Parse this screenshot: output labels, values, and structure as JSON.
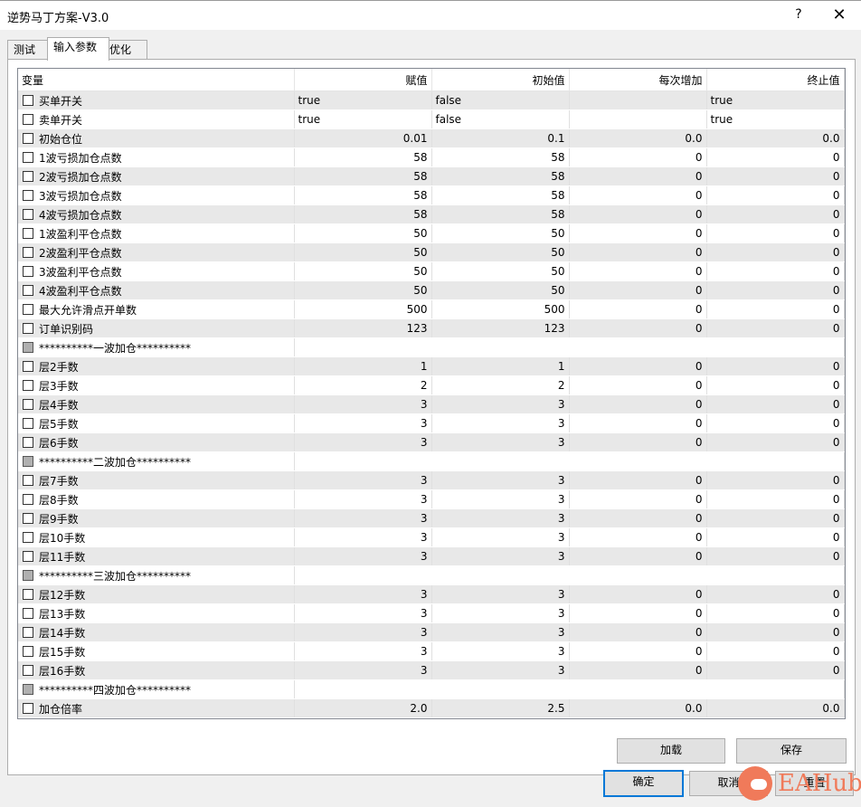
{
  "window": {
    "title": "逆势马丁方案-V3.0",
    "help": "?",
    "close": "✕"
  },
  "tabs": [
    "测试",
    "输入参数",
    "优化"
  ],
  "columns": [
    "变量",
    "赋值",
    "初始值",
    "每次增加",
    "终止值"
  ],
  "rows": [
    {
      "name": "买单开关",
      "value": "true",
      "start": "false",
      "step": "",
      "stop": "true",
      "type": "text"
    },
    {
      "name": "卖单开关",
      "value": "true",
      "start": "false",
      "step": "",
      "stop": "true",
      "type": "text"
    },
    {
      "name": "初始仓位",
      "value": "0.01",
      "start": "0.1",
      "step": "0.0",
      "stop": "0.0",
      "type": "num"
    },
    {
      "name": "1波亏损加仓点数",
      "value": "58",
      "start": "58",
      "step": "0",
      "stop": "0",
      "type": "num"
    },
    {
      "name": "2波亏损加仓点数",
      "value": "58",
      "start": "58",
      "step": "0",
      "stop": "0",
      "type": "num"
    },
    {
      "name": "3波亏损加仓点数",
      "value": "58",
      "start": "58",
      "step": "0",
      "stop": "0",
      "type": "num"
    },
    {
      "name": "4波亏损加仓点数",
      "value": "58",
      "start": "58",
      "step": "0",
      "stop": "0",
      "type": "num"
    },
    {
      "name": "1波盈利平仓点数",
      "value": "50",
      "start": "50",
      "step": "0",
      "stop": "0",
      "type": "num"
    },
    {
      "name": "2波盈利平仓点数",
      "value": "50",
      "start": "50",
      "step": "0",
      "stop": "0",
      "type": "num"
    },
    {
      "name": "3波盈利平仓点数",
      "value": "50",
      "start": "50",
      "step": "0",
      "stop": "0",
      "type": "num"
    },
    {
      "name": "4波盈利平仓点数",
      "value": "50",
      "start": "50",
      "step": "0",
      "stop": "0",
      "type": "num"
    },
    {
      "name": "最大允许滑点开单数",
      "value": "500",
      "start": "500",
      "step": "0",
      "stop": "0",
      "type": "num"
    },
    {
      "name": "订单识别码",
      "value": "123",
      "start": "123",
      "step": "0",
      "stop": "0",
      "type": "num"
    },
    {
      "name": "**********一波加仓**********",
      "type": "sep"
    },
    {
      "name": "层2手数",
      "value": "1",
      "start": "1",
      "step": "0",
      "stop": "0",
      "type": "num"
    },
    {
      "name": "层3手数",
      "value": "2",
      "start": "2",
      "step": "0",
      "stop": "0",
      "type": "num"
    },
    {
      "name": "层4手数",
      "value": "3",
      "start": "3",
      "step": "0",
      "stop": "0",
      "type": "num"
    },
    {
      "name": "层5手数",
      "value": "3",
      "start": "3",
      "step": "0",
      "stop": "0",
      "type": "num"
    },
    {
      "name": "层6手数",
      "value": "3",
      "start": "3",
      "step": "0",
      "stop": "0",
      "type": "num"
    },
    {
      "name": "**********二波加仓**********",
      "type": "sep"
    },
    {
      "name": "层7手数",
      "value": "3",
      "start": "3",
      "step": "0",
      "stop": "0",
      "type": "num"
    },
    {
      "name": "层8手数",
      "value": "3",
      "start": "3",
      "step": "0",
      "stop": "0",
      "type": "num"
    },
    {
      "name": "层9手数",
      "value": "3",
      "start": "3",
      "step": "0",
      "stop": "0",
      "type": "num"
    },
    {
      "name": "层10手数",
      "value": "3",
      "start": "3",
      "step": "0",
      "stop": "0",
      "type": "num"
    },
    {
      "name": "层11手数",
      "value": "3",
      "start": "3",
      "step": "0",
      "stop": "0",
      "type": "num"
    },
    {
      "name": "**********三波加仓**********",
      "type": "sep"
    },
    {
      "name": "层12手数",
      "value": "3",
      "start": "3",
      "step": "0",
      "stop": "0",
      "type": "num"
    },
    {
      "name": "层13手数",
      "value": "3",
      "start": "3",
      "step": "0",
      "stop": "0",
      "type": "num"
    },
    {
      "name": "层14手数",
      "value": "3",
      "start": "3",
      "step": "0",
      "stop": "0",
      "type": "num"
    },
    {
      "name": "层15手数",
      "value": "3",
      "start": "3",
      "step": "0",
      "stop": "0",
      "type": "num"
    },
    {
      "name": "层16手数",
      "value": "3",
      "start": "3",
      "step": "0",
      "stop": "0",
      "type": "num"
    },
    {
      "name": "**********四波加仓**********",
      "type": "sep"
    },
    {
      "name": "加仓倍率",
      "value": "2.0",
      "start": "2.5",
      "step": "0.0",
      "stop": "0.0",
      "type": "num"
    }
  ],
  "buttons": {
    "load": "加载",
    "save": "保存",
    "ok": "确定",
    "cancel": "取消",
    "reset": "重置"
  },
  "watermark": {
    "text": "EAHub"
  },
  "colors": {
    "alt_row": "#e8e8e8",
    "accent": "#0078d7",
    "watermark": "#f07a5a"
  }
}
